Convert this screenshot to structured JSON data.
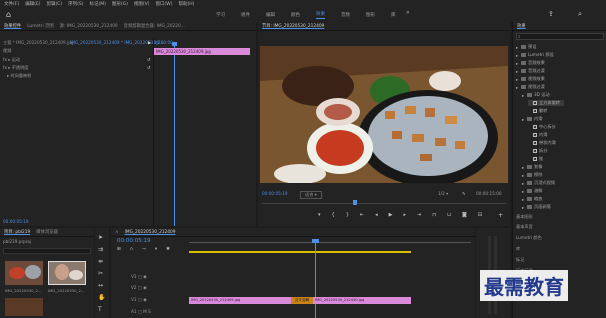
{
  "menu": [
    "文件(F)",
    "编辑(E)",
    "剪辑(C)",
    "序列(S)",
    "标记(M)",
    "图形(G)",
    "视图(V)",
    "窗口(W)",
    "帮助(H)"
  ],
  "workspaces": [
    "学习",
    "组件",
    "编辑",
    "颜色",
    "效果",
    "音频",
    "图形",
    "库"
  ],
  "active_workspace": "效果",
  "source_tabs": [
    "效果控件",
    "Lumetri 范围",
    "源: IMG_20220530_212409",
    "音频剪辑混合器: IMG_20220..."
  ],
  "effect_controls": {
    "clip_path": "主要 * IMG_20220530_212409.jpg",
    "seq_path": "IMG_20220530_212409 * IMG_20220530_2...",
    "start_time": "00:00:00",
    "clip_name": "IMG_20220530_212409.jpg",
    "video_label": "视频",
    "props": [
      "运动",
      "不透明度",
      "时间重映射"
    ],
    "time_bottom": "00:00:05:19"
  },
  "program": {
    "title": "节目: IMG_20220530_212409",
    "timecode": "00:00:05:19",
    "fit": "适合",
    "quality": "1/2",
    "duration": "00:00:15:00",
    "image_caption": "barbecue grill with skewers, grilled fish and food dishes"
  },
  "project": {
    "tabs": [
      "项目: pbl219",
      "媒体浏览器"
    ],
    "name": "pbl219.prproj",
    "items": [
      "IMG_20220530_2...",
      "IMG_20220530_2...",
      "IMG_20220530_2..."
    ]
  },
  "timeline": {
    "title": "IMG_20220530_212409",
    "timecode": "00:00:05:19",
    "clip1": "IMG_20220530_212409.jpg",
    "transition": "交叉溶解",
    "clip2": "IMG_20220530_212430.jpg",
    "tracks": [
      "V3",
      "V2",
      "V1",
      "A1"
    ]
  },
  "effects": {
    "title": "效果",
    "items": [
      {
        "label": "预设",
        "indent": 0,
        "type": "folder"
      },
      {
        "label": "Lumetri 预设",
        "indent": 0,
        "type": "folder"
      },
      {
        "label": "音频效果",
        "indent": 0,
        "type": "folder"
      },
      {
        "label": "音频过渡",
        "indent": 0,
        "type": "folder"
      },
      {
        "label": "视频效果",
        "indent": 0,
        "type": "folder"
      },
      {
        "label": "视频过渡",
        "indent": 0,
        "type": "folder"
      },
      {
        "label": "3D 运动",
        "indent": 1,
        "type": "folder"
      },
      {
        "label": "立方体旋转",
        "indent": 2,
        "type": "fx"
      },
      {
        "label": "翻转",
        "indent": 2,
        "type": "fx"
      },
      {
        "label": "内滑",
        "indent": 1,
        "type": "folder"
      },
      {
        "label": "中心拆分",
        "indent": 2,
        "type": "fx"
      },
      {
        "label": "内滑",
        "indent": 2,
        "type": "fx"
      },
      {
        "label": "带状内滑",
        "indent": 2,
        "type": "fx"
      },
      {
        "label": "拆分",
        "indent": 2,
        "type": "fx"
      },
      {
        "label": "推",
        "indent": 2,
        "type": "fx"
      },
      {
        "label": "划像",
        "indent": 1,
        "type": "folder"
      },
      {
        "label": "擦除",
        "indent": 1,
        "type": "folder"
      },
      {
        "label": "沉浸式视频",
        "indent": 1,
        "type": "folder"
      },
      {
        "label": "溶解",
        "indent": 1,
        "type": "folder"
      },
      {
        "label": "缩放",
        "indent": 1,
        "type": "folder"
      },
      {
        "label": "页面剥落",
        "indent": 1,
        "type": "folder"
      }
    ],
    "lower_panels": [
      "基本图形",
      "基本声音",
      "Lumetri 颜色",
      "库",
      "标记",
      "历史记录",
      "信息"
    ]
  },
  "watermark": "最需教育",
  "colors": {
    "accent": "#4c8fe3",
    "clip": "#d98ad9",
    "transition": "#c8861a",
    "work_area": "#d8c000"
  }
}
